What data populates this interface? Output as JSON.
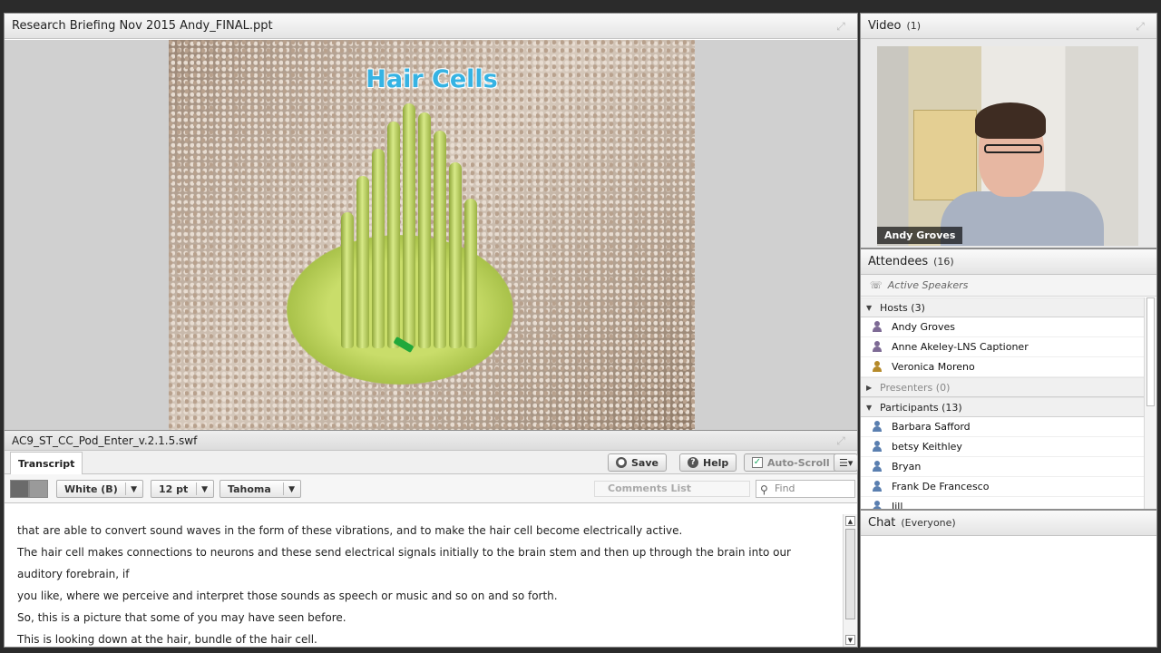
{
  "share": {
    "title": "Research Briefing Nov 2015 Andy_FINAL.ppt",
    "slide_title": "Hair Cells"
  },
  "captions": {
    "title": "AC9_ST_CC_Pod_Enter_v.2.1.5.swf",
    "tab_label": "Transcript",
    "save_label": "Save",
    "help_label": "Help",
    "autoscroll_label": "Auto-Scroll",
    "color_value": "White (B)",
    "size_value": "12 pt",
    "font_value": "Tahoma",
    "comments_label": "Comments List",
    "find_placeholder": "Find",
    "lines": [
      "that are able to convert sound waves in the form of these vibrations, and to make the hair cell become electrically active.",
      "The hair cell makes connections to neurons and these send electrical signals initially to the brain stem and then up through the brain into our auditory forebrain, if",
      "you like, where we perceive and interpret those sounds as speech or music and so on and so forth.",
      "So, this is a picture that some of you may have seen before.",
      "This is looking down at the hair, bundle of the hair cell."
    ]
  },
  "video": {
    "title": "Video",
    "count": "(1)",
    "speaker_name": "Andy Groves"
  },
  "attendees": {
    "title": "Attendees",
    "count": "(16)",
    "active_speakers_label": "Active Speakers",
    "hosts_label": "Hosts (3)",
    "hosts": [
      "Andy Groves",
      "Anne Akeley-LNS Captioner",
      "Veronica Moreno"
    ],
    "presenters_label": "Presenters (0)",
    "participants_label": "Participants (13)",
    "participants": [
      "Barbara Safford",
      "betsy Keithley",
      "Bryan",
      "Frank De Francesco",
      "Jill"
    ]
  },
  "chat": {
    "title": "Chat",
    "scope": "(Everyone)"
  },
  "colors": {
    "slide_title": "#36b3e3",
    "background": "#2b2b2b",
    "stage": "#d0d0d0"
  }
}
